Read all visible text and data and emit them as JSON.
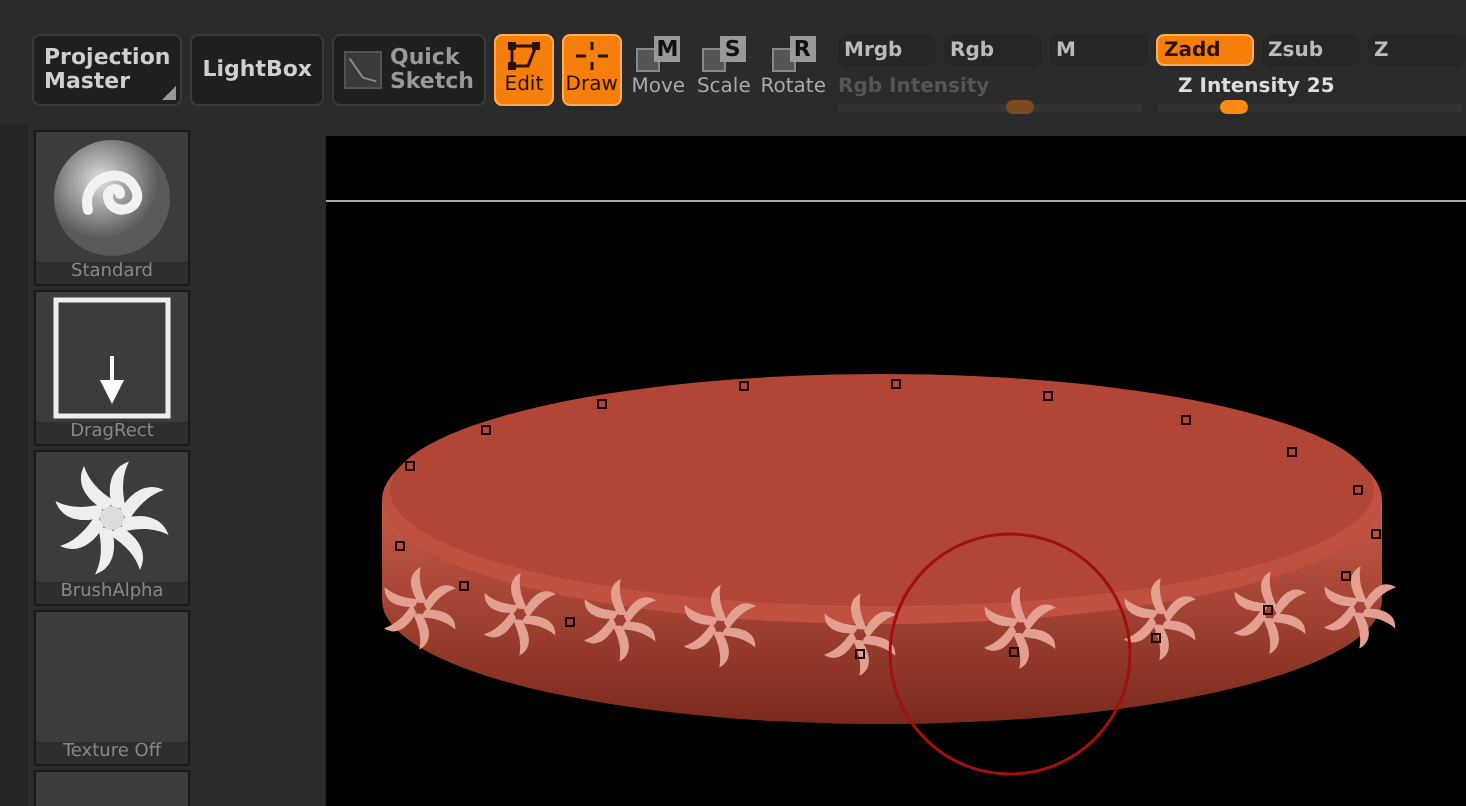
{
  "top_buttons": [
    {
      "label": "Projection Master",
      "kind": "menu"
    },
    {
      "label": "LightBox",
      "kind": "plain"
    },
    {
      "label": "Quick Sketch",
      "kind": "sketch"
    }
  ],
  "modes": [
    {
      "label": "Edit",
      "kind": "edit",
      "selected": true
    },
    {
      "label": "Draw",
      "kind": "draw",
      "selected": true
    },
    {
      "label": "Move",
      "kind": "key",
      "key": "M",
      "selected": false
    },
    {
      "label": "Scale",
      "kind": "key",
      "key": "S",
      "selected": false
    },
    {
      "label": "Rotate",
      "kind": "key",
      "key": "R",
      "selected": false
    }
  ],
  "color_modes": [
    {
      "label": "Mrgb",
      "selected": false
    },
    {
      "label": "Rgb",
      "selected": false
    },
    {
      "label": "M",
      "selected": false
    }
  ],
  "z_modes": [
    {
      "label": "Zadd",
      "selected": true
    },
    {
      "label": "Zsub",
      "selected": false
    },
    {
      "label": "Z",
      "selected": false
    }
  ],
  "rgb_intensity": {
    "label": "Rgb Intensity",
    "disabled": true,
    "level": 0.6
  },
  "z_intensity": {
    "label": "Z Intensity",
    "value": "25",
    "disabled": false,
    "level": 0.25
  },
  "brush_slots": [
    {
      "label": "Standard",
      "kind": "brush"
    },
    {
      "label": "DragRect",
      "kind": "stroke"
    },
    {
      "label": "BrushAlpha",
      "kind": "alpha"
    },
    {
      "label": "Texture Off",
      "kind": "empty"
    },
    {
      "kind": "material"
    }
  ]
}
